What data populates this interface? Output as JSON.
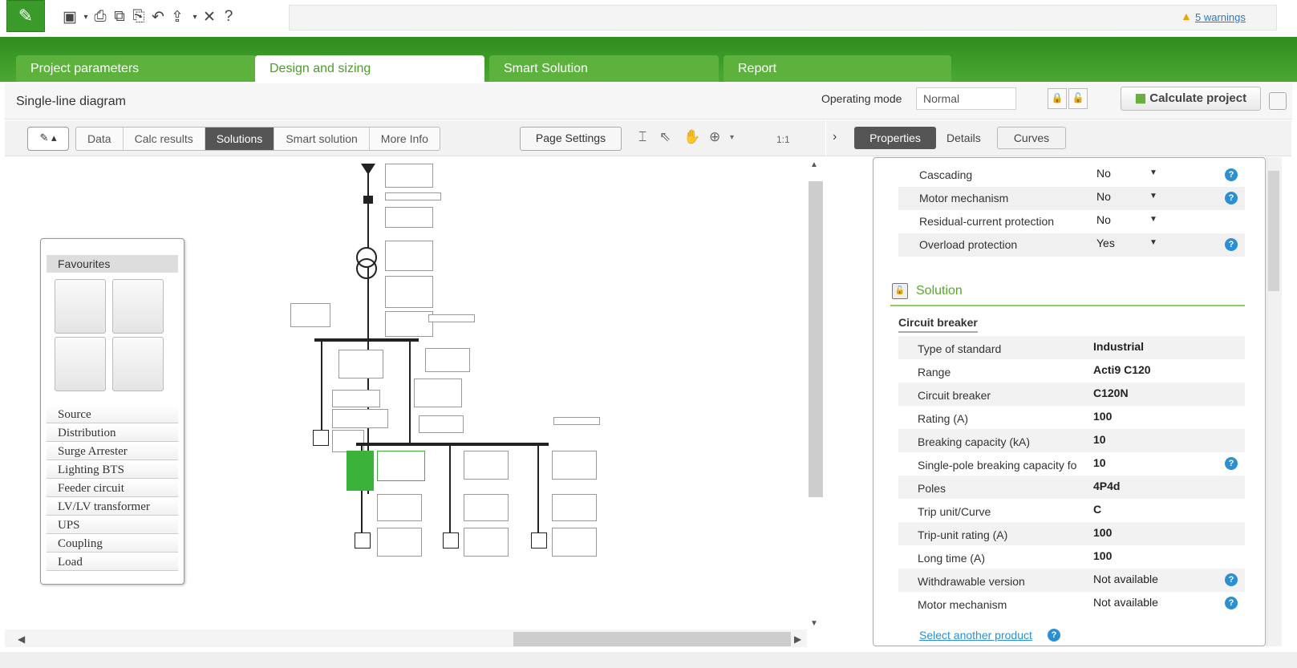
{
  "toolbar": {
    "icons": [
      "save-icon",
      "print-icon",
      "copy-icon",
      "paste-icon",
      "undo-icon",
      "export-icon",
      "tools-icon",
      "help-icon"
    ],
    "warnings": "5 warnings"
  },
  "tabs": [
    {
      "label": "Project parameters",
      "active": false
    },
    {
      "label": "Design and sizing",
      "active": true
    },
    {
      "label": "Smart Solution",
      "active": false
    },
    {
      "label": "Report",
      "active": false
    }
  ],
  "header": {
    "title": "Single-line diagram",
    "operating_mode_label": "Operating mode",
    "operating_mode_value": "Normal",
    "calculate_label": "Calculate project"
  },
  "diagram_toolbar": {
    "views": [
      "Data",
      "Calc results",
      "Solutions",
      "Smart solution",
      "More Info"
    ],
    "active_view": "Solutions",
    "page_settings": "Page Settings",
    "zoom": "1:1"
  },
  "palette": {
    "favourites": "Favourites",
    "categories": [
      "Source",
      "Distribution",
      "Surge Arrester",
      "Lighting BTS",
      "Feeder circuit",
      "LV/LV transformer",
      "UPS",
      "Coupling",
      "Load"
    ]
  },
  "right_panel": {
    "tabs": [
      "Properties",
      "Details",
      "Curves"
    ],
    "properties": [
      {
        "label": "Cascading",
        "value": "No",
        "help": true
      },
      {
        "label": "Motor mechanism",
        "value": "No",
        "help": true
      },
      {
        "label": "Residual-current protection",
        "value": "No",
        "help": false
      },
      {
        "label": "Overload protection",
        "value": "Yes",
        "help": true
      }
    ],
    "solution_title": "Solution",
    "circuit_breaker_title": "Circuit breaker",
    "solution_rows": [
      {
        "label": "Type of standard",
        "value": "Industrial",
        "bold": true,
        "help": false
      },
      {
        "label": "Range",
        "value": "Acti9 C120",
        "bold": true,
        "help": false
      },
      {
        "label": "Circuit breaker",
        "value": "C120N",
        "bold": true,
        "help": false
      },
      {
        "label": "Rating (A)",
        "value": "100",
        "bold": true,
        "help": false
      },
      {
        "label": "Breaking capacity (kA)",
        "value": "10",
        "bold": true,
        "help": false
      },
      {
        "label": "Single-pole breaking capacity fo",
        "value": "10",
        "bold": true,
        "help": true
      },
      {
        "label": "Poles",
        "value": "4P4d",
        "bold": true,
        "help": false
      },
      {
        "label": "Trip unit/Curve",
        "value": "C",
        "bold": true,
        "help": false
      },
      {
        "label": "Trip-unit rating (A)",
        "value": "100",
        "bold": true,
        "help": false
      },
      {
        "label": "Long time (A)",
        "value": "100",
        "bold": true,
        "help": false
      },
      {
        "label": "Withdrawable version",
        "value": "Not available",
        "bold": false,
        "help": true
      },
      {
        "label": "Motor mechanism",
        "value": "Not available",
        "bold": false,
        "help": true
      }
    ],
    "select_link": "Select another product"
  },
  "colors": {
    "brand_green": "#3a9a2a",
    "accent_link": "#2b8fd3",
    "warning": "#e8a400"
  }
}
